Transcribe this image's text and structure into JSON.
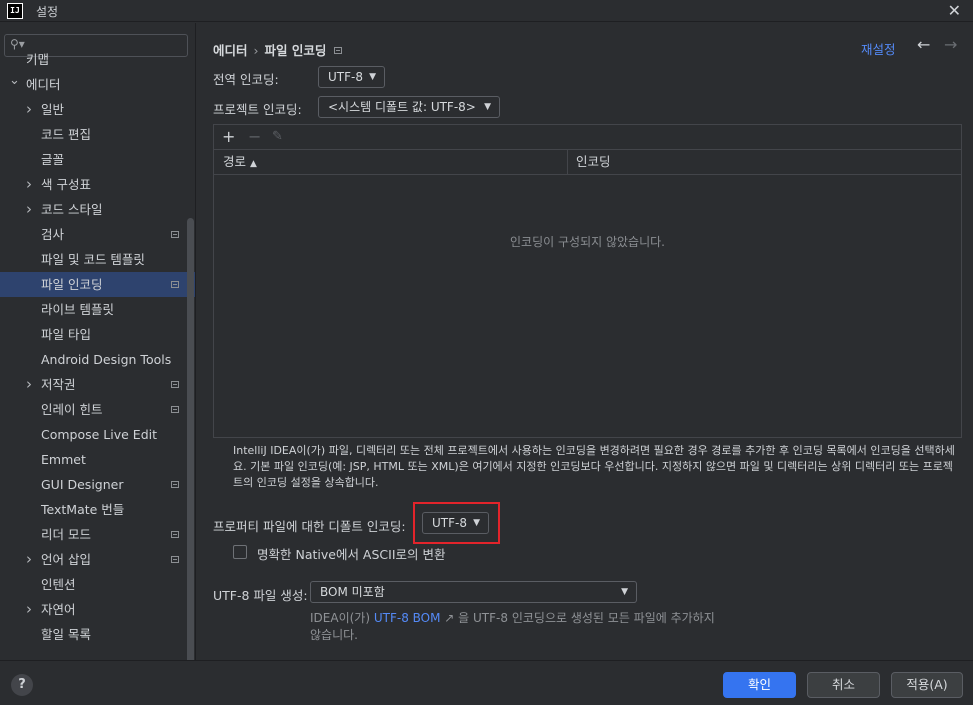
{
  "window": {
    "title": "설정",
    "app_icon_text": "IJ"
  },
  "sidebar": {
    "search_placeholder": "",
    "items": [
      {
        "label": "키맵",
        "level": 0,
        "arrow": ""
      },
      {
        "label": "에디터",
        "level": 0,
        "arrow": "down"
      },
      {
        "label": "일반",
        "level": 1,
        "arrow": "right"
      },
      {
        "label": "코드 편집",
        "level": 1,
        "arrow": ""
      },
      {
        "label": "글꼴",
        "level": 1,
        "arrow": ""
      },
      {
        "label": "색 구성표",
        "level": 1,
        "arrow": "right"
      },
      {
        "label": "코드 스타일",
        "level": 1,
        "arrow": "right"
      },
      {
        "label": "검사",
        "level": 1,
        "arrow": "",
        "modified": true
      },
      {
        "label": "파일 및 코드 템플릿",
        "level": 1,
        "arrow": ""
      },
      {
        "label": "파일 인코딩",
        "level": 1,
        "arrow": "",
        "modified": true,
        "selected": true
      },
      {
        "label": "라이브 템플릿",
        "level": 1,
        "arrow": ""
      },
      {
        "label": "파일 타입",
        "level": 1,
        "arrow": ""
      },
      {
        "label": "Android Design Tools",
        "level": 1,
        "arrow": ""
      },
      {
        "label": "저작권",
        "level": 1,
        "arrow": "right",
        "modified": true
      },
      {
        "label": "인레이 힌트",
        "level": 1,
        "arrow": "",
        "modified": true
      },
      {
        "label": "Compose Live Edit",
        "level": 1,
        "arrow": ""
      },
      {
        "label": "Emmet",
        "level": 1,
        "arrow": ""
      },
      {
        "label": "GUI Designer",
        "level": 1,
        "arrow": "",
        "modified": true
      },
      {
        "label": "TextMate 번들",
        "level": 1,
        "arrow": ""
      },
      {
        "label": "리더 모드",
        "level": 1,
        "arrow": "",
        "modified": true
      },
      {
        "label": "언어 삽입",
        "level": 1,
        "arrow": "right",
        "modified": true
      },
      {
        "label": "인텐션",
        "level": 1,
        "arrow": ""
      },
      {
        "label": "자연어",
        "level": 1,
        "arrow": "right"
      },
      {
        "label": "할일 목록",
        "level": 1,
        "arrow": ""
      }
    ]
  },
  "header": {
    "breadcrumb_parent": "에디터",
    "breadcrumb_separator": "›",
    "breadcrumb_current": "파일 인코딩",
    "reset_label": "재설정"
  },
  "settings": {
    "global_encoding_label": "전역 인코딩:",
    "global_encoding_value": "UTF-8",
    "project_encoding_label": "프로젝트 인코딩:",
    "project_encoding_value": "<시스템 디폴트 값: UTF-8>",
    "table": {
      "col_path": "경로",
      "col_encoding": "인코딩",
      "empty_text": "인코딩이 구성되지 않았습니다."
    },
    "description": "IntelliJ IDEA이(가) 파일, 디렉터리 또는 전체 프로젝트에서 사용하는 인코딩을 변경하려면 필요한 경우 경로를 추가한 후 인코딩 목록에서 인코딩을 선택하세요. 기본 파일 인코딩(예: JSP, HTML 또는 XML)은 여기에서 지정한 인코딩보다 우선합니다. 지정하지 않으면 파일 및 디렉터리는 상위 디렉터리 또는 프로젝트의 인코딩 설정을 상속합니다.",
    "properties_encoding_label": "프로퍼티 파일에 대한 디폴트 인코딩:",
    "properties_encoding_value": "UTF-8",
    "native_ascii_label": "명확한 Native에서 ASCII로의 변환",
    "native_ascii_checked": false,
    "bom_label": "UTF-8 파일 생성:",
    "bom_value": "BOM 미포함",
    "bom_desc_prefix": "IDEA이(가) ",
    "bom_desc_link": "UTF-8 BOM",
    "bom_desc_link_arrow": "↗",
    "bom_desc_suffix": " 을 UTF-8 인코딩으로 생성된 모든 파일에 추가하지 않습니다."
  },
  "footer": {
    "help_label": "?",
    "ok_label": "확인",
    "cancel_label": "취소",
    "apply_label": "적용(A)"
  },
  "colors": {
    "background": "#2b2d30",
    "selection": "#2e436e",
    "accent": "#3574f0",
    "link": "#548af7",
    "highlight": "#e3242b"
  }
}
